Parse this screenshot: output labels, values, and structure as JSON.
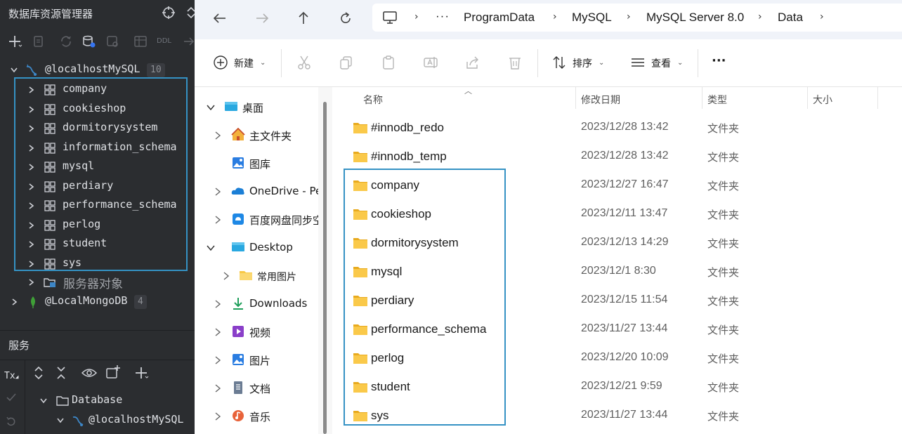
{
  "ide": {
    "title": "数据库资源管理器",
    "toolbar": {
      "ddl_label": "DDL"
    },
    "connection_mysql": {
      "label": "@localhostMySQL",
      "count": "10"
    },
    "databases": [
      "company",
      "cookieshop",
      "dormitorysystem",
      "information_schema",
      "mysql",
      "perdiary",
      "performance_schema",
      "perlog",
      "student",
      "sys"
    ],
    "server_objects": "服务器对象",
    "connection_mongo": {
      "label": "@LocalMongoDB",
      "count": "4"
    },
    "services": {
      "title": "服务",
      "tx_label": "Tx",
      "tree_database": "Database",
      "tree_connection": "@localhostMySQL"
    }
  },
  "explorer": {
    "breadcrumb": [
      "ProgramData",
      "MySQL",
      "MySQL Server 8.0",
      "Data"
    ],
    "breadcrumb_more": "···",
    "commands": {
      "new": "新建",
      "sort": "排序",
      "view": "查看",
      "more": "···"
    },
    "nav": [
      {
        "label": "桌面",
        "icon": "desktop-icon"
      },
      {
        "label": "主文件夹",
        "icon": "home-icon"
      },
      {
        "label": "图库",
        "icon": "gallery-icon"
      },
      {
        "label": "OneDrive - Pe",
        "icon": "onedrive-icon"
      },
      {
        "label": "百度网盘同步空",
        "icon": "baidu-netdisk-icon"
      },
      {
        "label": "Desktop",
        "icon": "desktop-folder-icon"
      },
      {
        "label": "常用图片",
        "icon": "folder-icon"
      },
      {
        "label": "Downloads",
        "icon": "download-icon"
      },
      {
        "label": "视频",
        "icon": "video-icon"
      },
      {
        "label": "图片",
        "icon": "pictures-icon"
      },
      {
        "label": "文档",
        "icon": "documents-icon"
      },
      {
        "label": "音乐",
        "icon": "music-icon"
      }
    ],
    "columns": {
      "name": "名称",
      "date": "修改日期",
      "type": "类型",
      "size": "大小"
    },
    "files": [
      {
        "name": "#innodb_redo",
        "date": "2023/12/28 13:42",
        "type": "文件夹"
      },
      {
        "name": "#innodb_temp",
        "date": "2023/12/28 13:42",
        "type": "文件夹"
      },
      {
        "name": "company",
        "date": "2023/12/27 16:47",
        "type": "文件夹"
      },
      {
        "name": "cookieshop",
        "date": "2023/12/11 13:47",
        "type": "文件夹"
      },
      {
        "name": "dormitorysystem",
        "date": "2023/12/13 14:29",
        "type": "文件夹"
      },
      {
        "name": "mysql",
        "date": "2023/12/1 8:30",
        "type": "文件夹"
      },
      {
        "name": "perdiary",
        "date": "2023/12/15 11:54",
        "type": "文件夹"
      },
      {
        "name": "performance_schema",
        "date": "2023/11/27 13:44",
        "type": "文件夹"
      },
      {
        "name": "perlog",
        "date": "2023/12/20 10:09",
        "type": "文件夹"
      },
      {
        "name": "student",
        "date": "2023/12/21 9:59",
        "type": "文件夹"
      },
      {
        "name": "sys",
        "date": "2023/11/27 13:44",
        "type": "文件夹"
      }
    ]
  },
  "colors": {
    "ide_bg": "#2b2d30",
    "highlight": "#3592c4",
    "folder": "#f8c846"
  }
}
